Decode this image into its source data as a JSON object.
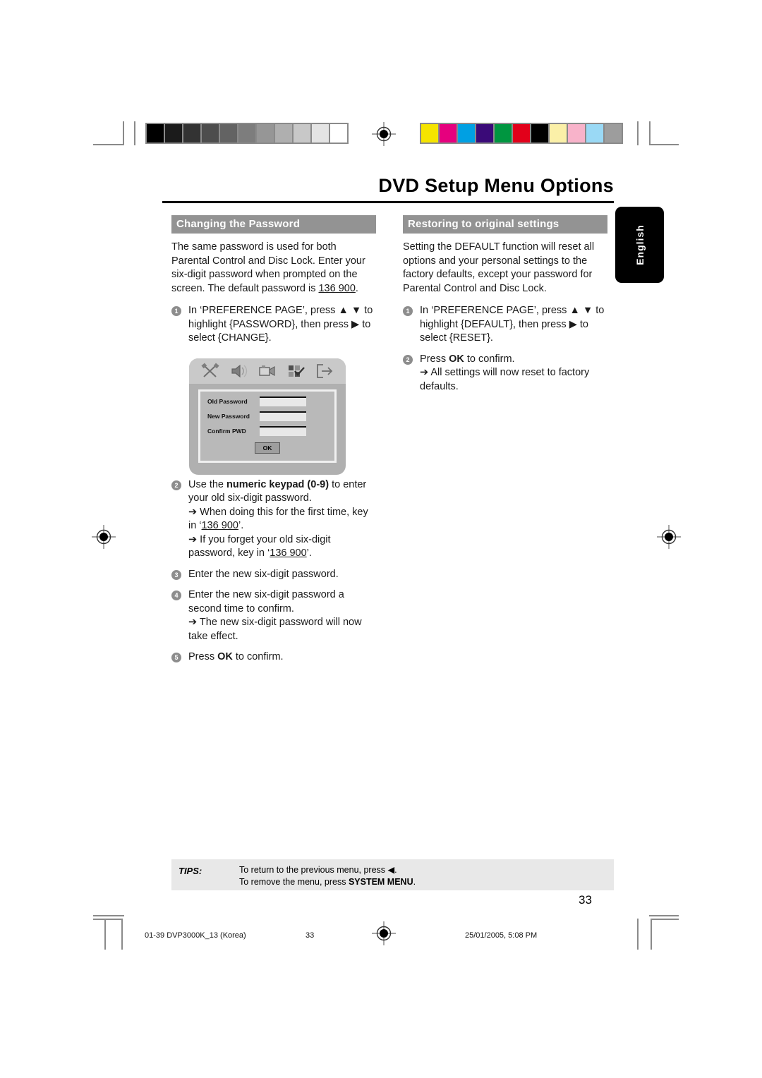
{
  "document": {
    "headline": "DVD Setup Menu Options",
    "page_number": "33",
    "language_tab": "English"
  },
  "left_column": {
    "section_title": "Changing the Password",
    "intro_1": "The same password is used for both Parental Control and Disc Lock. Enter your six-digit password when prompted on the screen. The default password is ",
    "intro_default_password": "136 900",
    "intro_1_end": ".",
    "step1_num": "1",
    "step1_text": "In ‘PREFERENCE PAGE’, press ▲ ▼ to highlight {PASSWORD}, then press ▶ to select {CHANGE}.",
    "step2_num": "2",
    "step2_pre": "Use the ",
    "step2_bold": "numeric keypad (0-9)",
    "step2_post": " to enter your old six-digit password.",
    "step2_sub1_pre": "➔ When doing this for the first time, key in ‘",
    "step2_sub1_code": "136 900",
    "step2_sub1_post": "’.",
    "step2_sub2_pre": "➔ If you forget your old six-digit password, key in ‘",
    "step2_sub2_code": "136 900",
    "step2_sub2_post": "’.",
    "step3_num": "3",
    "step3_text": "Enter the new six-digit password.",
    "step4_num": "4",
    "step4_text": "Enter the new six-digit password a second time to confirm.",
    "step4_sub": "➔ The new six-digit password will now take effect.",
    "step5_num": "5",
    "step5_pre": "Press ",
    "step5_bold": "OK",
    "step5_post": " to confirm."
  },
  "right_column": {
    "section_title": "Restoring to original settings",
    "intro": "Setting the DEFAULT function will reset all options and your personal settings to the factory defaults, except your password for Parental Control and Disc Lock.",
    "step1_num": "1",
    "step1_text": "In ‘PREFERENCE PAGE’, press ▲ ▼ to highlight {DEFAULT}, then press ▶ to select {RESET}.",
    "step2_num": "2",
    "step2_pre": "Press ",
    "step2_bold": "OK",
    "step2_post": " to confirm.",
    "step2_sub": "➔ All settings will now reset to factory defaults."
  },
  "osd_screen": {
    "icons": [
      "tools-icon",
      "speaker-icon",
      "video-icon",
      "checklist-icon",
      "exit-icon"
    ],
    "fields": [
      {
        "label": "Old Password",
        "value": ""
      },
      {
        "label": "New Password",
        "value": ""
      },
      {
        "label": "Confirm PWD",
        "value": ""
      }
    ],
    "ok_button": "OK"
  },
  "tips": {
    "label": "TIPS:",
    "line1": "To return to the previous menu, press ◀.",
    "line2_pre": "To remove the menu, press ",
    "line2_bold": "SYSTEM MENU",
    "line2_post": "."
  },
  "print_footer": {
    "file": "01-39 DVP3000K_13 (Korea)",
    "page": "33",
    "timestamp": "25/01/2005, 5:08 PM"
  },
  "calibration": {
    "grayscale": [
      "#000000",
      "#1b1b1b",
      "#333333",
      "#4d4d4d",
      "#636363",
      "#7d7d7d",
      "#969696",
      "#afafaf",
      "#c8c8c8",
      "#e4e4e4",
      "#ffffff"
    ],
    "colors": [
      "#f5e400",
      "#e6007e",
      "#00a0e3",
      "#3a0a78",
      "#009640",
      "#e2001a",
      "#000000",
      "#fbf0a8",
      "#f8b3ca",
      "#9ad9f5",
      "#9d9d9d"
    ]
  }
}
